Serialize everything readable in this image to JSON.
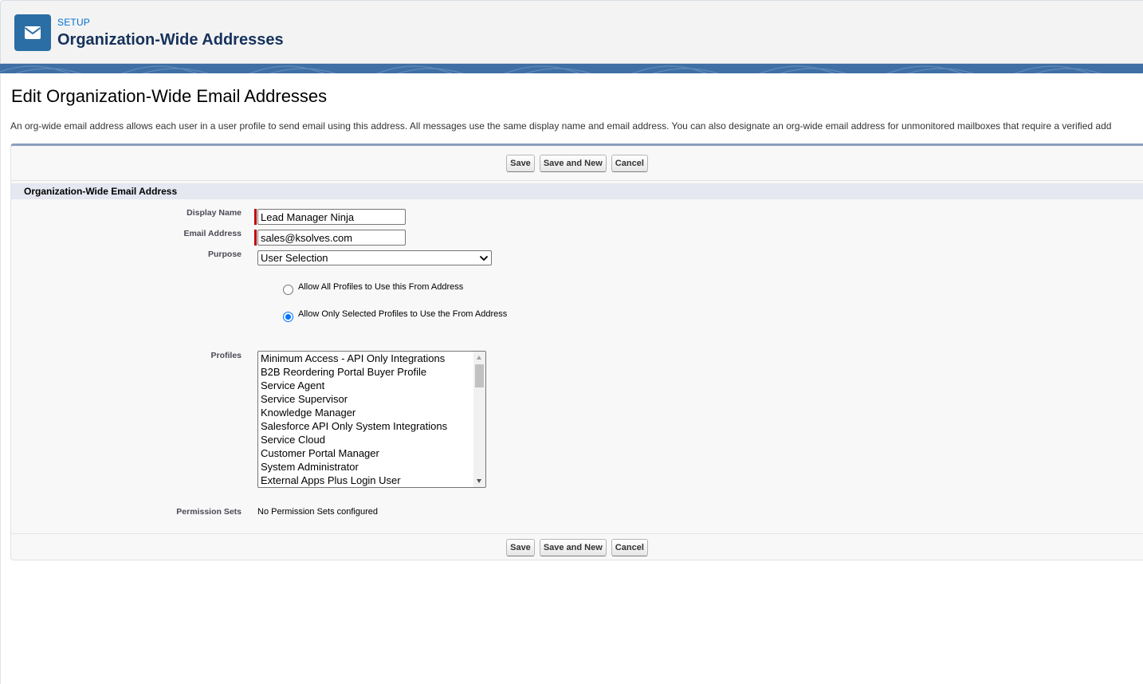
{
  "header": {
    "icon": "email-icon",
    "eyebrow": "SETUP",
    "title": "Organization-Wide Addresses"
  },
  "page": {
    "title": "Edit Organization-Wide Email Addresses",
    "description": "An org-wide email address allows each user in a user profile to send email using this address. All messages use the same display name and email address. You can also designate an org-wide email address for unmonitored mailboxes that require a verified add"
  },
  "buttons": {
    "save": "Save",
    "save_and_new": "Save and New",
    "cancel": "Cancel"
  },
  "section": {
    "title": "Organization-Wide Email Address"
  },
  "fields": {
    "display_name": {
      "label": "Display Name",
      "value": "Lead Manager Ninja",
      "required": true
    },
    "email_address": {
      "label": "Email Address",
      "value": "sales@ksolves.com",
      "required": true
    },
    "purpose": {
      "label": "Purpose",
      "selected": "User Selection"
    }
  },
  "radios": {
    "allow_all": {
      "label": "Allow All Profiles to Use this From Address",
      "checked": false
    },
    "allow_selected": {
      "label": "Allow Only Selected Profiles to Use the From Address",
      "checked": true
    }
  },
  "profiles": {
    "label": "Profiles",
    "items": [
      "Minimum Access - API Only Integrations",
      "B2B Reordering Portal Buyer Profile",
      "Service Agent",
      "Service Supervisor",
      "Knowledge Manager",
      "Salesforce API Only System Integrations",
      "Service Cloud",
      "Customer Portal Manager",
      "System Administrator",
      "External Apps Plus Login User"
    ]
  },
  "permission_sets": {
    "label": "Permission Sets",
    "value": "No Permission Sets configured"
  },
  "colors": {
    "header_icon_bg": "#2a6ea5",
    "eyebrow": "#0070d2",
    "required_bar": "#c00000",
    "section_bg": "#e5e7f1",
    "band": "#3f6fa5"
  }
}
